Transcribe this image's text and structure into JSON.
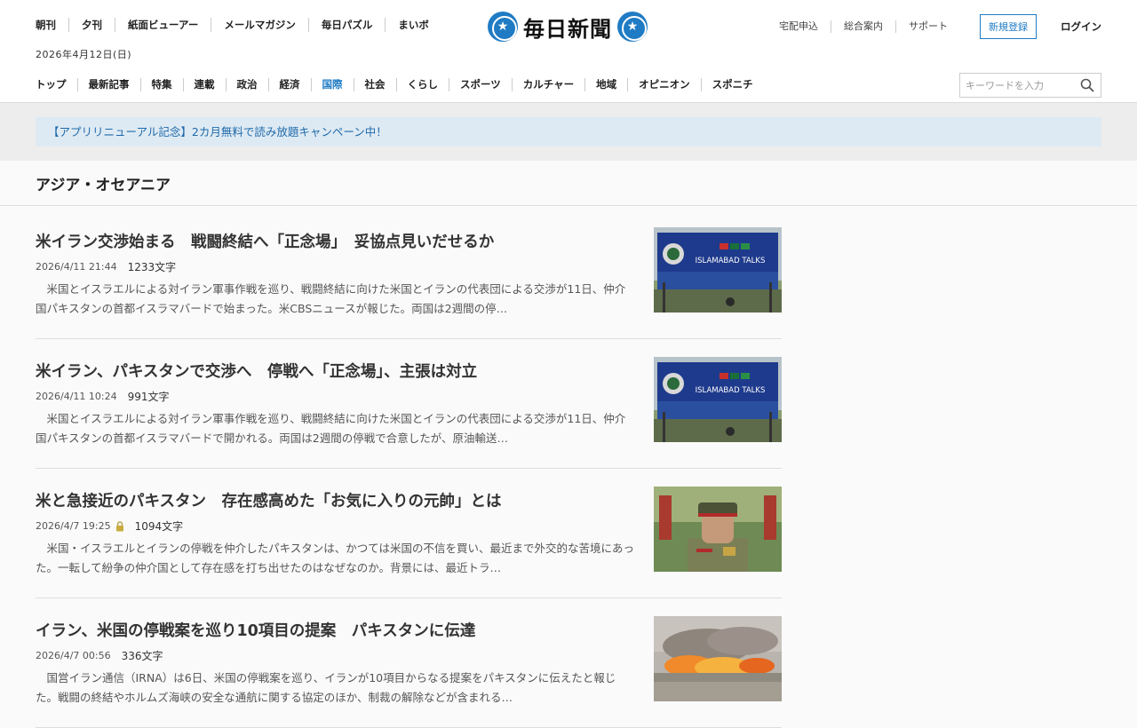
{
  "header": {
    "top_links": [
      "朝刊",
      "夕刊",
      "紙面ビューアー",
      "メールマガジン",
      "毎日パズル",
      "まいボ"
    ],
    "date": "2026年4月12日(日)",
    "logo_text": "毎日新聞",
    "utility_links": [
      "宅配申込",
      "総合案内",
      "サポート"
    ],
    "register_label": "新規登録",
    "login_label": "ログイン",
    "nav": [
      "トップ",
      "最新記事",
      "特集",
      "連載",
      "政治",
      "経済",
      "国際",
      "社会",
      "くらし",
      "スポーツ",
      "カルチャー",
      "地域",
      "オピニオン",
      "スポニチ"
    ],
    "active_nav": "国際",
    "search_placeholder": "キーワードを入力",
    "brand_color": "#1f7bc4"
  },
  "campaign": {
    "text": "【アプリリニューアル記念】2カ月無料で読み放題キャンペーン中！"
  },
  "section": {
    "title": "アジア・オセアニア"
  },
  "articles": [
    {
      "title": "米イラン交渉始まる　戦闘終結へ「正念場」　妥協点見いだせるか",
      "date": "2026/4/11 21:44",
      "chars": "1233文字",
      "locked": false,
      "excerpt": "米国とイスラエルによる対イラン軍事作戦を巡り、戦闘終結に向けた米国とイランの代表団による交渉が11日、仲介国パキスタンの首都イスラマバードで始まった。米CBSニュースが報じた。両国は2週間の停…",
      "image": "islamabad-talks-billboard",
      "image_text": "ISLAMABAD TALKS"
    },
    {
      "title": "米イラン、パキスタンで交渉へ　停戦へ「正念場」、主張は対立",
      "date": "2026/4/11 10:24",
      "chars": "991文字",
      "locked": false,
      "excerpt": "米国とイスラエルによる対イラン軍事作戦を巡り、戦闘終結に向けた米国とイランの代表団による交渉が11日、仲介国パキスタンの首都イスラマバードで開かれる。両国は2週間の停戦で合意したが、原油輸送…",
      "image": "islamabad-talks-billboard",
      "image_text": "ISLAMABAD TALKS"
    },
    {
      "title": "米と急接近のパキスタン　存在感高めた「お気に入りの元帥」とは",
      "date": "2026/4/7 19:25",
      "chars": "1094文字",
      "locked": true,
      "excerpt": "米国・イスラエルとイランの停戦を仲介したパキスタンは、かつては米国の不信を買い、最近まで外交的な苦境にあった。一転して紛争の仲介国として存在感を打ち出せたのはなぜなのか。背景には、最近トラ…",
      "image": "field-marshal-portrait",
      "image_text": ""
    },
    {
      "title": "イラン、米国の停戦案を巡り10項目の提案　パキスタンに伝達",
      "date": "2026/4/7 00:56",
      "chars": "336文字",
      "locked": false,
      "excerpt": "国営イラン通信（IRNA）は6日、米国の停戦案を巡り、イランが10項目からなる提案をパキスタンに伝えたと報じた。戦闘の終結やホルムズ海峡の安全な通航に関する協定のほか、制裁の解除などが含まれる…",
      "image": "fire-explosion",
      "image_text": ""
    }
  ]
}
